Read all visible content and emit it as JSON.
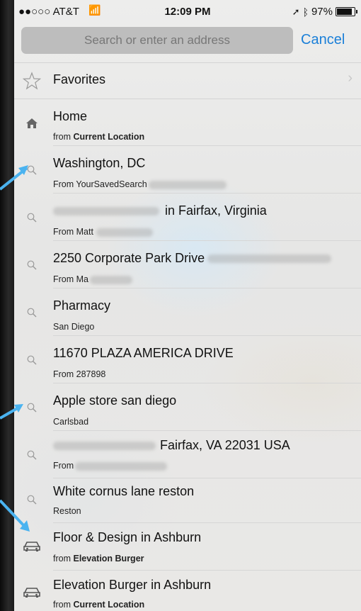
{
  "status": {
    "carrier": "●●○○○ AT&T",
    "time": "12:09 PM",
    "battery": "97%"
  },
  "search": {
    "placeholder": "Search or enter an address",
    "cancel": "Cancel"
  },
  "favorites": {
    "label": "Favorites"
  },
  "rows": [
    {
      "title": "Home",
      "sub_prefix": "from ",
      "sub_bold": "Current Location",
      "icon": "house-icon"
    },
    {
      "title": "Washington, DC",
      "sub_prefix": "From YourSavedSearch",
      "icon": "magnifier-icon"
    },
    {
      "title": "in Fairfax, Virginia",
      "sub_prefix": "From Matt",
      "icon": "magnifier-icon"
    },
    {
      "title": "2250 Corporate Park Drive",
      "sub_prefix": "From Ma",
      "icon": "magnifier-icon"
    },
    {
      "title": "Pharmacy",
      "sub_prefix": "San Diego",
      "icon": "magnifier-icon"
    },
    {
      "title": "11670 PLAZA AMERICA DRIVE",
      "sub_prefix": "From 287898",
      "icon": "magnifier-icon"
    },
    {
      "title": "Apple store san diego",
      "sub_prefix": "Carlsbad",
      "icon": "magnifier-icon"
    },
    {
      "title": "Fairfax, VA  22031  USA",
      "sub_prefix": "From",
      "icon": "magnifier-icon"
    },
    {
      "title": "White cornus lane reston",
      "sub_prefix": "Reston",
      "icon": "magnifier-icon"
    },
    {
      "title": "Floor & Design in Ashburn",
      "sub_prefix": "from ",
      "sub_bold": "Elevation Burger",
      "icon": "car-icon"
    },
    {
      "title": "Elevation Burger in Ashburn",
      "sub_prefix": "from ",
      "sub_bold": "Current Location",
      "icon": "car-icon"
    }
  ],
  "colors": {
    "accent": "#1a7fd8",
    "arrow": "#4ab3f0"
  }
}
